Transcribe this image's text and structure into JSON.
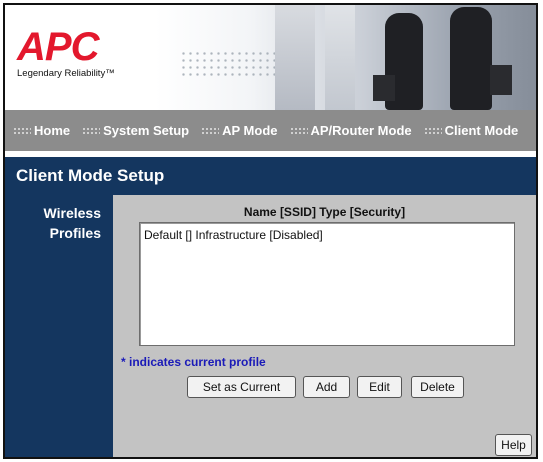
{
  "brand": {
    "logo_text": "APC",
    "tagline": "Legendary Reliability™"
  },
  "nav": {
    "items": [
      {
        "label": "Home"
      },
      {
        "label": "System Setup"
      },
      {
        "label": "AP Mode"
      },
      {
        "label": "AP/Router Mode"
      },
      {
        "label": "Client Mode"
      }
    ]
  },
  "page": {
    "title": "Client Mode Setup",
    "section_label_line1": "Wireless",
    "section_label_line2": "Profiles",
    "column_header": "Name [SSID] Type [Security]",
    "profiles": [
      "Default [] Infrastructure [Disabled]"
    ],
    "current_note": "* indicates current profile"
  },
  "buttons": {
    "set_current": "Set as Current",
    "add": "Add",
    "edit": "Edit",
    "delete": "Delete",
    "help": "Help"
  },
  "colors": {
    "brand_red": "#e3182d",
    "nav_gray": "#8c8c8c",
    "panel_navy": "#14365f",
    "content_gray": "#c3c3c3",
    "note_blue": "#1a1ab8"
  }
}
